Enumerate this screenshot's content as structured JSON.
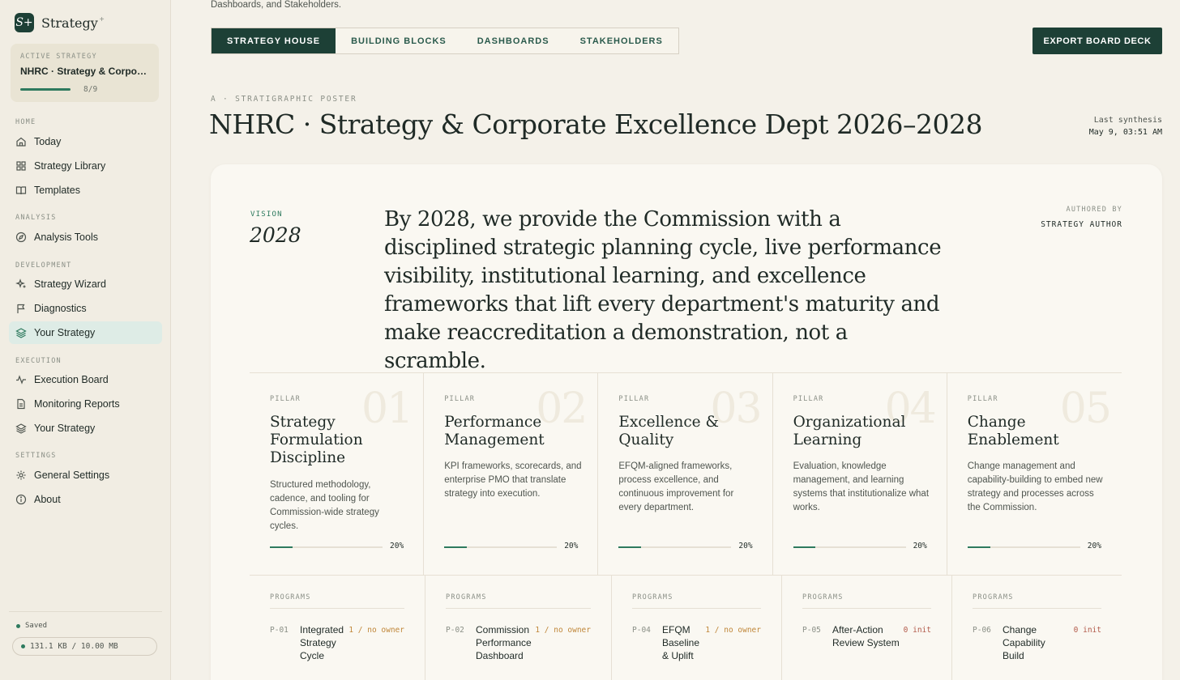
{
  "app": {
    "logo_mark": "S+",
    "name": "Strategy",
    "name_sup": "+"
  },
  "active_strategy": {
    "label": "ACTIVE STRATEGY",
    "name": "NHRC · Strategy & Corporat...",
    "progress": "8/9",
    "progress_value": 0.89
  },
  "nav": {
    "sections": [
      {
        "title": "HOME",
        "items": [
          {
            "label": "Today",
            "icon": "home-icon"
          },
          {
            "label": "Strategy Library",
            "icon": "grid-icon"
          },
          {
            "label": "Templates",
            "icon": "book-icon"
          }
        ]
      },
      {
        "title": "ANALYSIS",
        "items": [
          {
            "label": "Analysis Tools",
            "icon": "compass-icon"
          }
        ]
      },
      {
        "title": "DEVELOPMENT",
        "items": [
          {
            "label": "Strategy Wizard",
            "icon": "sparkle-icon"
          },
          {
            "label": "Diagnostics",
            "icon": "flag-icon"
          },
          {
            "label": "Your Strategy",
            "icon": "layers-icon",
            "active": true
          }
        ]
      },
      {
        "title": "EXECUTION",
        "items": [
          {
            "label": "Execution Board",
            "icon": "activity-icon"
          },
          {
            "label": "Monitoring Reports",
            "icon": "file-icon"
          },
          {
            "label": "Your Strategy",
            "icon": "layers-icon"
          }
        ]
      },
      {
        "title": "SETTINGS",
        "items": [
          {
            "label": "General Settings",
            "icon": "gear-icon"
          },
          {
            "label": "About",
            "icon": "info-icon"
          }
        ]
      }
    ]
  },
  "footer": {
    "saved": "Saved",
    "storage": "131.1 KB / 10.00 MB"
  },
  "header": {
    "subtitle": "Dashboards, and Stakeholders.",
    "export": "EXPORT BOARD DECK"
  },
  "tabs": [
    {
      "label": "STRATEGY HOUSE",
      "active": true
    },
    {
      "label": "BUILDING BLOCKS"
    },
    {
      "label": "DASHBOARDS"
    },
    {
      "label": "STAKEHOLDERS"
    }
  ],
  "page": {
    "eyebrow": "A · STRATIGRAPHIC POSTER",
    "title": "NHRC · Strategy & Corporate Excellence Dept 2026–2028",
    "synthesis_label": "Last synthesis",
    "synthesis_date": "May 9, 03:51 AM"
  },
  "vision": {
    "label": "VISION",
    "year": "2028",
    "text": "By 2028, we provide the Commission with a disciplined strategic planning cycle, live performance visibility, institutional learning, and excellence frameworks that lift every department's maturity and make reaccreditation a demonstration, not a scramble.",
    "authored_label": "AUTHORED BY",
    "author": "STRATEGY AUTHOR"
  },
  "pillars": [
    {
      "num": "01",
      "label": "PILLAR",
      "title": "Strategy Formulation Discipline",
      "desc": "Structured methodology, cadence, and tooling for Commission-wide strategy cycles.",
      "pct": "20%",
      "progress": 0.2
    },
    {
      "num": "02",
      "label": "PILLAR",
      "title": "Performance Management",
      "desc": "KPI frameworks, scorecards, and enterprise PMO that translate strategy into execution.",
      "pct": "20%",
      "progress": 0.2
    },
    {
      "num": "03",
      "label": "PILLAR",
      "title": "Excellence & Quality",
      "desc": "EFQM-aligned frameworks, process excellence, and continuous improvement for every department.",
      "pct": "20%",
      "progress": 0.2
    },
    {
      "num": "04",
      "label": "PILLAR",
      "title": "Organizational Learning",
      "desc": "Evaluation, knowledge management, and learning systems that institutionalize what works.",
      "pct": "20%",
      "progress": 0.2
    },
    {
      "num": "05",
      "label": "PILLAR",
      "title": "Change Enablement",
      "desc": "Change management and capability-building to embed new strategy and processes across the Commission.",
      "pct": "20%",
      "progress": 0.2
    }
  ],
  "programs": [
    {
      "label": "PROGRAMS",
      "id": "P-01",
      "name": "Integrated Strategy Cycle",
      "status": "1 / no owner",
      "tone": "amber"
    },
    {
      "label": "PROGRAMS",
      "id": "P-02",
      "name": "Commission Performance Dashboard",
      "status": "1 / no owner",
      "tone": "amber"
    },
    {
      "label": "PROGRAMS",
      "id": "P-04",
      "name": "EFQM Baseline & Uplift",
      "status": "1 / no owner",
      "tone": "amber"
    },
    {
      "label": "PROGRAMS",
      "id": "P-05",
      "name": "After-Action Review System",
      "status": "0 init",
      "tone": "red"
    },
    {
      "label": "PROGRAMS",
      "id": "P-06",
      "name": "Change Capability Build",
      "status": "0 init",
      "tone": "red"
    }
  ],
  "colors": {
    "accent": "#1d4036",
    "progress": "#2e7a5e",
    "active_nav": "#deece6"
  }
}
